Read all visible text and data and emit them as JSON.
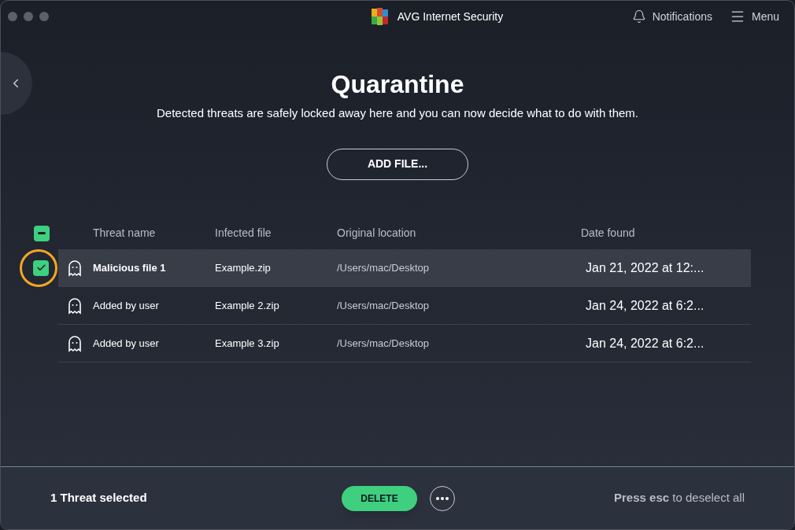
{
  "window": {
    "title": "AVG Internet Security"
  },
  "header_actions": [
    {
      "kind": "bell",
      "label": "Notifications"
    },
    {
      "kind": "menu",
      "label": "Menu"
    }
  ],
  "page": {
    "title": "Quarantine",
    "subtitle": "Detected threats are safely locked away here and you can now decide what to do with them.",
    "add_button": "ADD FILE..."
  },
  "table": {
    "select_all": {
      "partial": true
    },
    "columns": [
      "Threat name",
      "Infected file",
      "Original location",
      "Date found"
    ],
    "rows": [
      {
        "threat": "Malicious file 1",
        "file": "Example.zip",
        "location": "/Users/mac/Desktop",
        "date": "Jan 21, 2022 at 12:...",
        "selected": true,
        "highlighted": true
      },
      {
        "threat": "Added by user",
        "file": "Example 2.zip",
        "location": "/Users/mac/Desktop",
        "date": "Jan 24, 2022 at 6:2...",
        "selected": false,
        "highlighted": false
      },
      {
        "threat": "Added by user",
        "file": "Example 3.zip",
        "location": "/Users/mac/Desktop",
        "date": "Jan 24, 2022 at 6:2...",
        "selected": false,
        "highlighted": false
      }
    ]
  },
  "footer": {
    "selection": "1 Threat selected",
    "delete_button": "DELETE",
    "hint": "**Press esc** to deselect all"
  }
}
